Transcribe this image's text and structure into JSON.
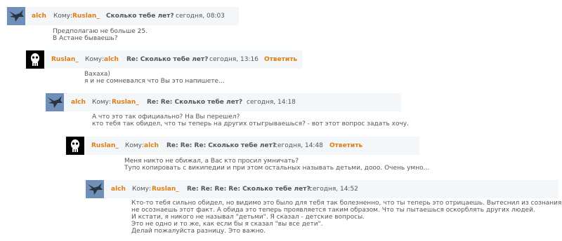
{
  "messages": [
    {
      "author": "alch",
      "to_label": "Кому:",
      "to_name": "Ruslan_",
      "subject": "Сколько тебе лет?",
      "date": "сегодня, 08:03",
      "reply": "",
      "avatar_icon": "hawk-avatar-icon",
      "lines": [
        "Предполагаю не больше 25.",
        "В Астане бываешь?"
      ]
    },
    {
      "author": "Ruslan_",
      "to_label": "Кому:",
      "to_name": "alch",
      "subject": "Re: Сколько тебе лет?",
      "date": "сегодня, 13:16",
      "reply": "Ответить",
      "avatar_icon": "skull-avatar-icon",
      "lines": [
        "Вахаха)",
        "я и не сомневался что Вы это напишете..."
      ]
    },
    {
      "author": "alch",
      "to_label": "Кому:",
      "to_name": "Ruslan_",
      "subject": "Re: Re: Сколько тебе лет?",
      "date": "сегодня, 14:18",
      "reply": "",
      "avatar_icon": "hawk-avatar-icon",
      "lines": [
        "А что это так официально? На Вы перешел?",
        "кто тебя так обидел, что ты теперь на других отыгрываешься? - вот этот вопрос задать хочу."
      ]
    },
    {
      "author": "Ruslan_",
      "to_label": "Кому:",
      "to_name": "alch",
      "subject": "Re: Re: Re: Сколько тебе лет?",
      "date": "сегодня, 14:48",
      "reply": "Ответить",
      "avatar_icon": "skull-avatar-icon",
      "lines": [
        "Меня никто не обижал, а Вас кто просил умничать?",
        "Тупо копировать с википедии и при этом остальных называть детьми, дооо. Очень умно..."
      ]
    },
    {
      "author": "alch",
      "to_label": "Кому:",
      "to_name": "Ruslan_",
      "subject": "Re: Re: Re: Re: Сколько тебе лет?",
      "date": "сегодня, 14:52",
      "reply": "",
      "avatar_icon": "hawk-avatar-icon",
      "lines": [
        "Кто-то тебя сильно обидел, но видимо это было для тебя так болезненно, что ты теперь это отрицаешь. Вытеснил из сознания и",
        "не осознаешь этот факт. А обида это теперь проявляется таким образом. Что ты пытаешься оскорблять других людей.",
        "И кстати, я никого не называл \"детьми\". Я сказал - детские вопросы.",
        "Это не одно и то же, как если бы я сказал \"вы все дети\".",
        "Делай пожалуйста разницу. Это важно."
      ]
    }
  ]
}
